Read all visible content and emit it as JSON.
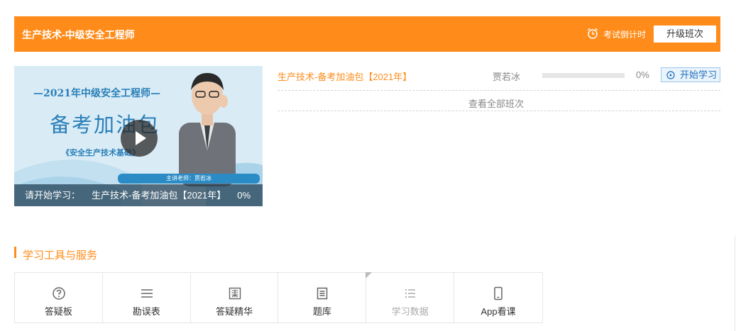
{
  "header": {
    "title": "生产技术-中级安全工程师",
    "countdown_label": "考试倒计时",
    "countdown_icon": "alarm-clock-icon",
    "upgrade_label": "升级班次",
    "bg_color": "#ff8c1a"
  },
  "cover": {
    "subtitle": "—2021年中级安全工程师—",
    "headline": "备考加油包",
    "subject": "《安全生产技术基础》",
    "teacher_strip": "主讲老师：贾若冰",
    "play_icon": "play-icon",
    "prompt_label": "请开始学习：",
    "prompt_course": "生产技术-备考加油包【2021年】",
    "prompt_percent": "0%"
  },
  "course": {
    "name": "生产技术-备考加油包【2021年】",
    "teacher": "贾若冰",
    "progress": 0,
    "percent_label": "0%",
    "start_label": "开始学习",
    "start_icon": "play-circle-icon",
    "view_all_label": "查看全部班次"
  },
  "tools": {
    "section_title": "学习工具与服务",
    "items": [
      {
        "label": "答疑板",
        "icon": "question-circle-icon",
        "enabled": true
      },
      {
        "label": "勘误表",
        "icon": "list-lines-icon",
        "enabled": true
      },
      {
        "label": "答疑精华",
        "icon": "book-grid-icon",
        "enabled": true
      },
      {
        "label": "题库",
        "icon": "document-list-icon",
        "enabled": true
      },
      {
        "label": "学习数据",
        "icon": "bullet-list-icon",
        "enabled": false
      },
      {
        "label": "App看课",
        "icon": "mobile-phone-icon",
        "enabled": true
      }
    ]
  }
}
